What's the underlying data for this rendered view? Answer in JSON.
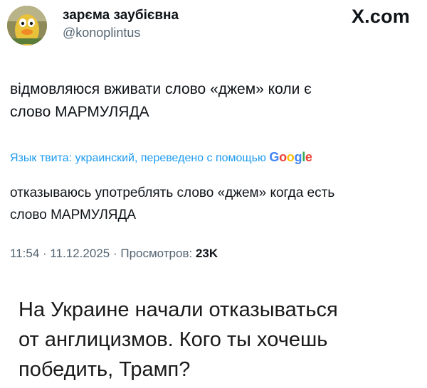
{
  "tweet": {
    "display_name": "зарєма заубієвна",
    "handle": "@konoplintus",
    "brand": "X.com",
    "original_text_line1": "відмовляюся вживати слово «джем» коли є",
    "original_text_line2": "слово МАРМУЛЯДА",
    "translation_label": "Язык твита: украинский, переведено с помощью",
    "translation_provider": "Google",
    "translated_text_line1": "отказываюсь употреблять слово «джем» когда есть",
    "translated_text_line2": "слово МАРМУЛЯДА",
    "time": "11:54",
    "date": "11.12.2025",
    "views_label": "Просмотров:",
    "views_count": "23K"
  },
  "caption": {
    "line1": "На Украине начали отказываться",
    "line2": "от англицизмов. Кого ты хочешь",
    "line3": "победить, Трамп?"
  },
  "colors": {
    "link_blue": "#1d9bf0",
    "secondary_gray": "#536471",
    "text_dark": "#0f1419"
  }
}
